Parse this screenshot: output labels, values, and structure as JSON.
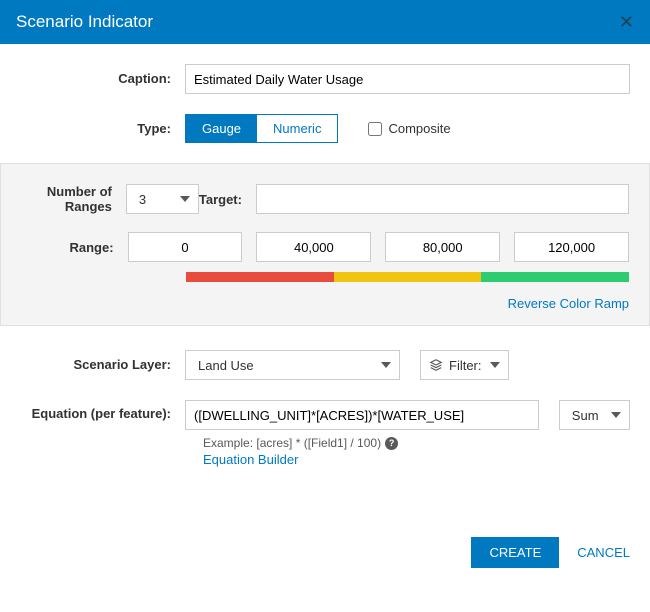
{
  "header": {
    "title": "Scenario Indicator"
  },
  "caption": {
    "label": "Caption:",
    "value": "Estimated Daily Water Usage"
  },
  "type": {
    "label": "Type:",
    "gauge": "Gauge",
    "numeric": "Numeric",
    "composite": "Composite"
  },
  "ranges": {
    "num_label": "Number of Ranges",
    "num_value": "3",
    "target_label": "Target:",
    "target_value": "",
    "range_label": "Range:",
    "values": [
      "0",
      "40,000",
      "80,000",
      "120,000"
    ],
    "colors": [
      "#e84c3d",
      "#f1c40f",
      "#2ecc71"
    ],
    "reverse_label": "Reverse Color Ramp"
  },
  "scenario": {
    "layer_label": "Scenario Layer:",
    "layer_value": "Land Use",
    "filter_label": "Filter:"
  },
  "equation": {
    "label": "Equation (per feature):",
    "value": "([DWELLING_UNIT]*[ACRES])*[WATER_USE]",
    "agg": "Sum",
    "example": "Example: [acres] * ([Field1] / 100)",
    "builder": "Equation Builder"
  },
  "footer": {
    "create": "CREATE",
    "cancel": "CANCEL"
  }
}
